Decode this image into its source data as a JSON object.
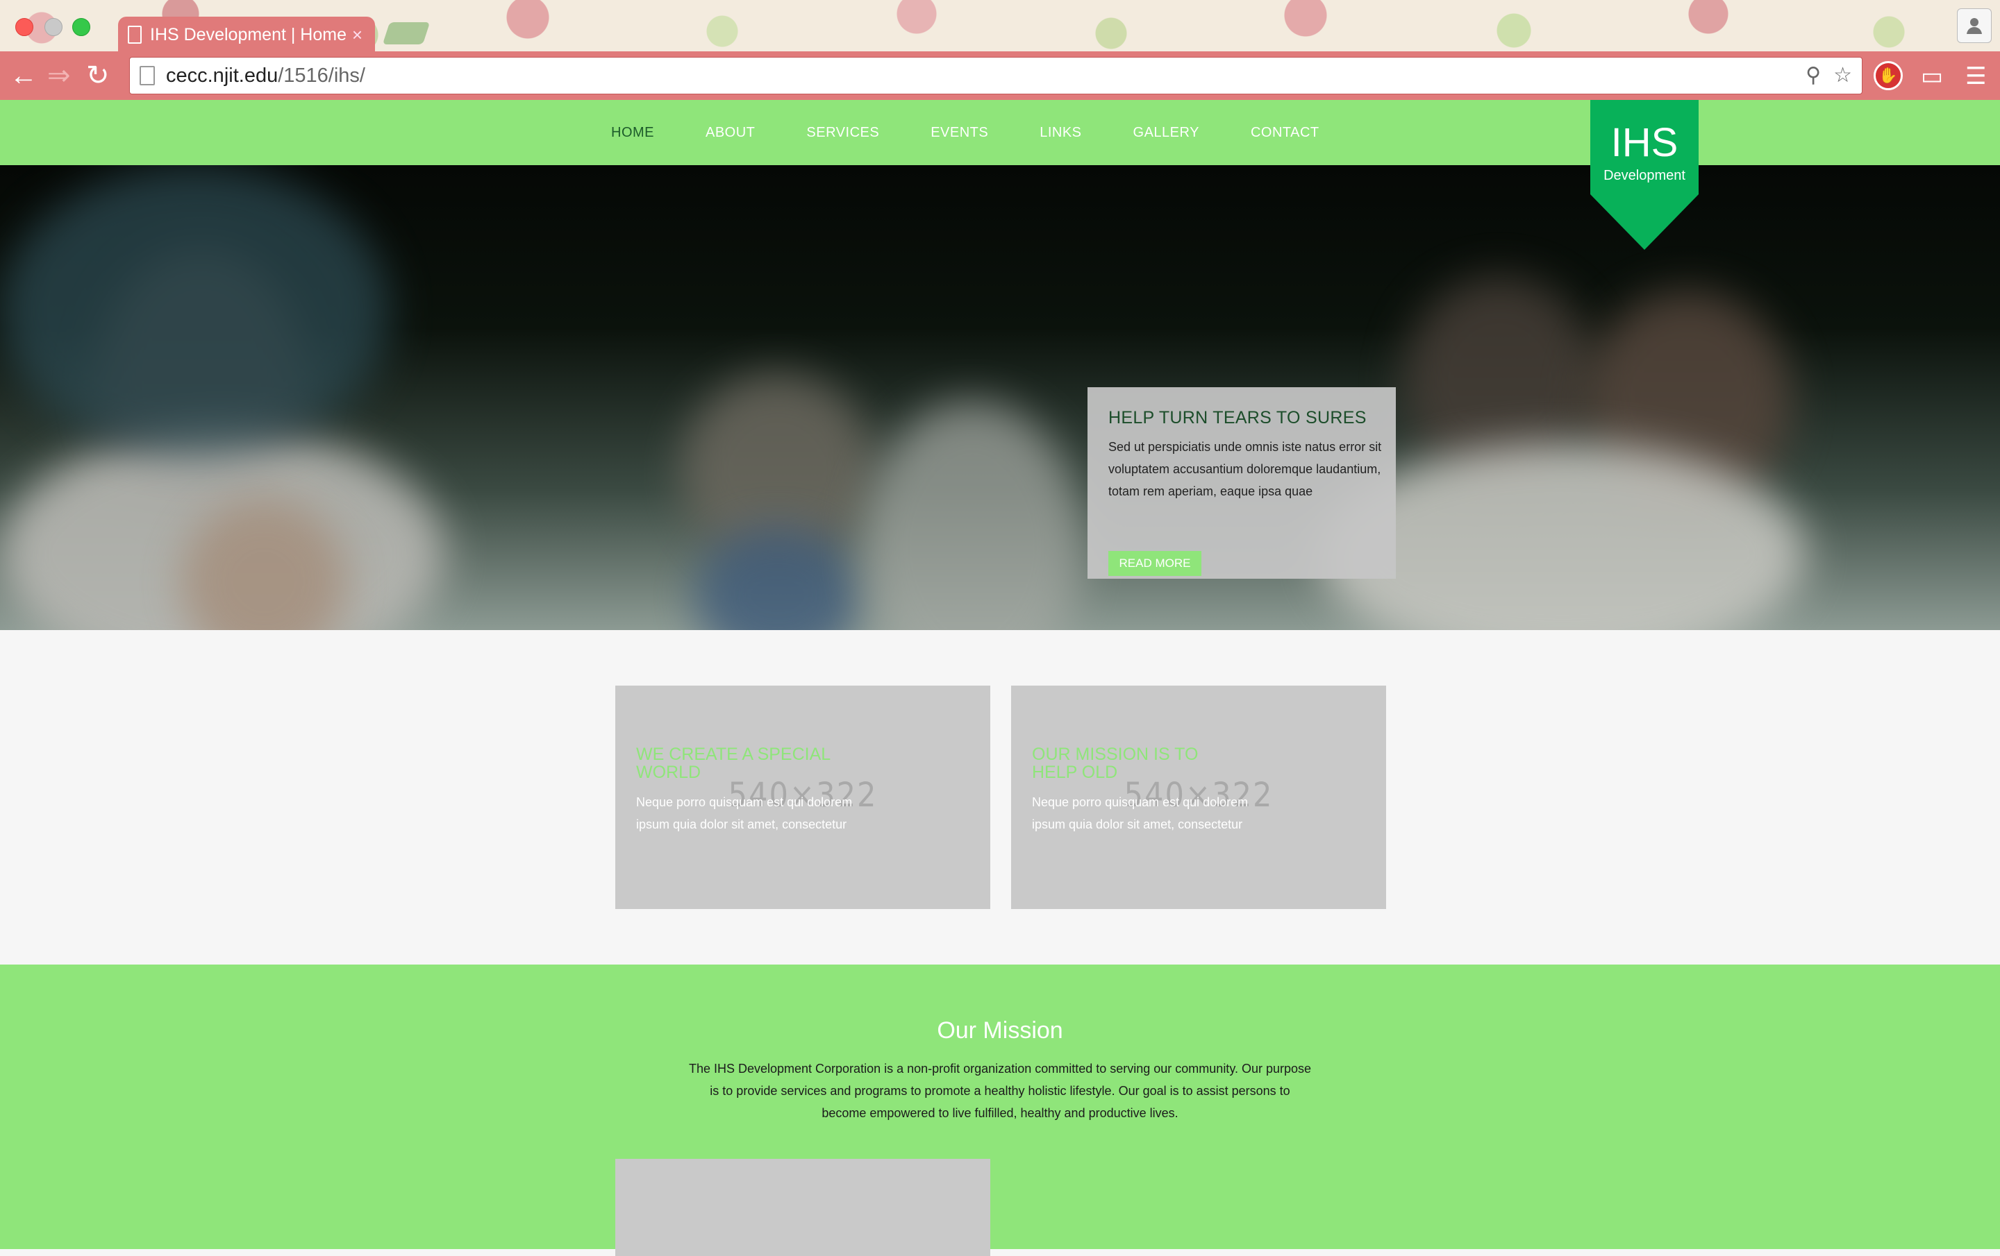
{
  "browser": {
    "tab_title": "IHS Development | Home",
    "tab_close": "×",
    "url_host": "cecc.njit.edu",
    "url_path": "/1516/ihs/",
    "profile_icon": "person-icon"
  },
  "nav": {
    "items": [
      {
        "label": "HOME",
        "active": true
      },
      {
        "label": "ABOUT"
      },
      {
        "label": "SERVICES"
      },
      {
        "label": "EVENTS"
      },
      {
        "label": "LINKS"
      },
      {
        "label": "GALLERY"
      },
      {
        "label": "CONTACT"
      }
    ]
  },
  "logo": {
    "main": "IHS",
    "sub": "Development"
  },
  "hero": {
    "title": "HELP TURN TEARS TO SURES",
    "body": "Sed ut perspiciatis unde omnis iste natus error sit voluptatem accusantium doloremque laudantium, totam rem aperiam, eaque ipsa quae",
    "button": "READ MORE"
  },
  "features": [
    {
      "placeholder": "540×322",
      "title": "WE CREATE A SPECIAL WORLD",
      "body": "Neque porro quisquam est qui dolorem ipsum quia dolor sit amet, consectetur"
    },
    {
      "placeholder": "540×322",
      "title": "OUR MISSION IS TO HELP OLD",
      "body": "Neque porro quisquam est qui dolorem ipsum quia dolor sit amet, consectetur"
    }
  ],
  "mission": {
    "title": "Our Mission",
    "body": "The IHS Development Corporation is a non-profit organization committed to serving our community. Our purpose is to provide services and programs to promote a healthy holistic lifestyle. Our goal is to assist persons to become empowered to live fulfilled, healthy and productive lives."
  },
  "colors": {
    "brand_green": "#8fe57a",
    "logo_green": "#08b159",
    "chrome_pink": "#e07a7a"
  }
}
